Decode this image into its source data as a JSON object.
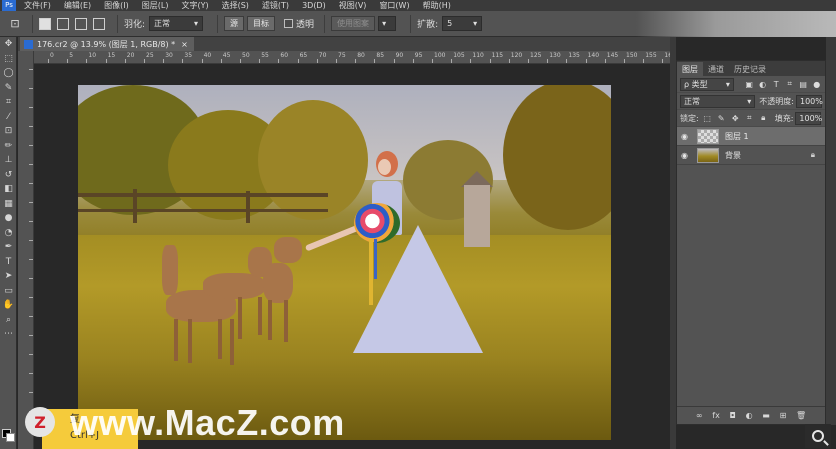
{
  "menu": {
    "logo": "Ps",
    "items": [
      "文件(F)",
      "编辑(E)",
      "图像(I)",
      "图层(L)",
      "文字(Y)",
      "选择(S)",
      "滤镜(T)",
      "3D(D)",
      "视图(V)",
      "窗口(W)",
      "帮助(H)"
    ]
  },
  "options": {
    "feather_label": "羽化:",
    "style_value": "正常",
    "source_button": "源",
    "target_button": "目标",
    "transparent_label": "透明",
    "use_pattern_button": "使用图案",
    "diffuse_label": "扩散:",
    "diffuse_value": "5"
  },
  "document": {
    "tab_title": "176.cr2 @ 13.9% (图层 1, RGB/8) *",
    "ruler_numbers": [
      "0",
      "5",
      "10",
      "15",
      "20",
      "25",
      "30",
      "35",
      "40",
      "45",
      "50",
      "55",
      "60",
      "65",
      "70",
      "75",
      "80",
      "85",
      "90",
      "95",
      "100",
      "105",
      "110",
      "115",
      "120",
      "125",
      "130",
      "135",
      "140",
      "145",
      "150",
      "155",
      "160"
    ]
  },
  "layers_panel": {
    "tabs": [
      "图层",
      "通道",
      "历史记录"
    ],
    "filter_kind": "ρ 类型",
    "blend_mode": "正常",
    "opacity_label": "不透明度:",
    "opacity_value": "100%",
    "lock_label": "锁定:",
    "fill_label": "填充:",
    "fill_value": "100%",
    "layers": [
      {
        "name": "图层 1",
        "selected": true
      },
      {
        "name": "背景",
        "selected": false,
        "locked": true
      }
    ],
    "bottom_icons": [
      "link-icon",
      "fx-icon",
      "mask-icon",
      "adjustment-icon",
      "folder-icon",
      "new-layer-icon",
      "trash-icon"
    ]
  },
  "overlay": {
    "tooltip_line1": "复",
    "tooltip_line2": "Ctrl+J",
    "watermark": "www.MacZ.com",
    "logo_letter": "Z"
  },
  "colors": {
    "ps_blue": "#2a6bd1",
    "tooltip_yellow": "#f5cb3b",
    "panel_gray": "#535353"
  }
}
